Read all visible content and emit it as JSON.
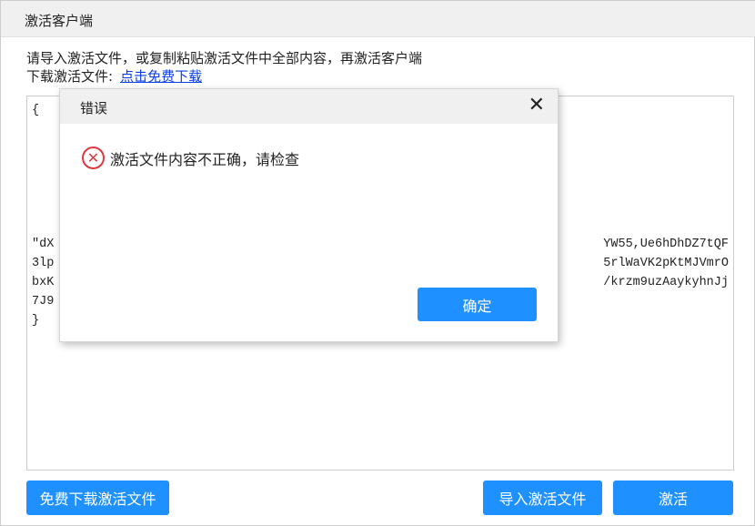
{
  "window": {
    "title": "激活客户端"
  },
  "intro": {
    "line1": "请导入激活文件，或复制粘贴激活文件中全部内容，再激活客户端",
    "line2_label": "下载激活文件:",
    "download_link": "点击免费下载"
  },
  "textarea": {
    "lines": [
      {
        "left": "{",
        "right": ""
      },
      {
        "left": "",
        "right": ""
      },
      {
        "left": "",
        "right": ""
      },
      {
        "left": "",
        "right": ""
      },
      {
        "left": "",
        "right": ""
      },
      {
        "left": "",
        "right": ""
      },
      {
        "left": "",
        "right": ""
      },
      {
        "left": "\"dX",
        "right": "YW55,Ue6hDhDZ7tQF"
      },
      {
        "left": "3lp",
        "right": "5rlWaVK2pKtMJVmrO"
      },
      {
        "left": "bxK",
        "right": "/krzm9uzAaykyhnJj"
      },
      {
        "left": "7J9",
        "right": ""
      },
      {
        "left": "}",
        "right": ""
      }
    ]
  },
  "buttons": {
    "free_download": "免费下载激活文件",
    "import": "导入激活文件",
    "activate": "激活"
  },
  "dialog": {
    "title": "错误",
    "close": "✕",
    "icon": "✕",
    "message": "激活文件内容不正确，请检查",
    "ok": "确定"
  }
}
